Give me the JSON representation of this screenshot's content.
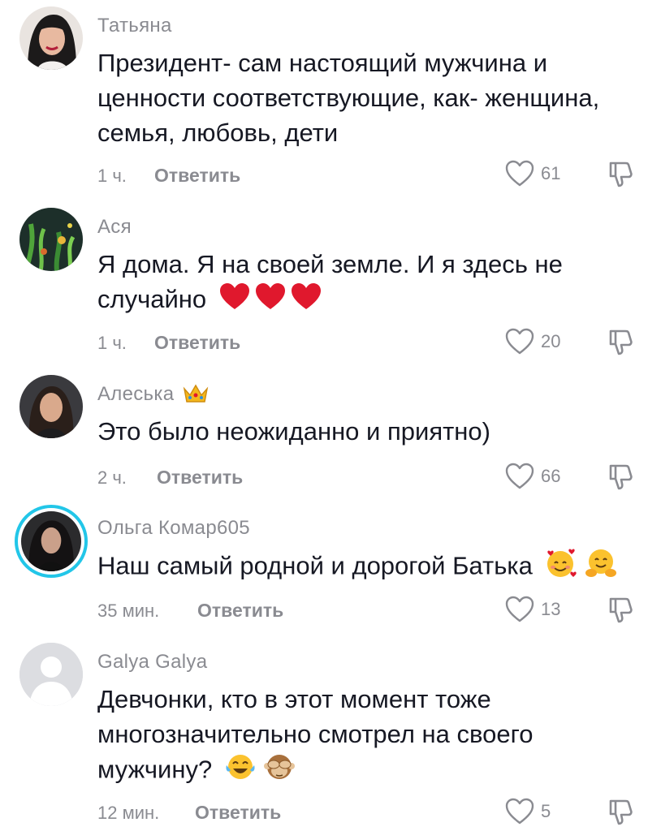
{
  "comments": [
    {
      "username": "Татьяна",
      "lines": [
        "Президент- сам настоящий мужчина и",
        "ценности соответствующие, как- женщина,",
        "семья, любовь, дети"
      ],
      "time": "1 ч.",
      "reply_label": "Ответить",
      "likes": "61",
      "avatar": "woman-dark-hair-avatar"
    },
    {
      "username": "Ася",
      "lines": [
        "Я дома. Я на своей земле. И я здесь не",
        "случайно"
      ],
      "emojis": [
        "red-heart",
        "red-heart",
        "red-heart"
      ],
      "time": "1 ч.",
      "reply_label": "Ответить",
      "likes": "20",
      "avatar": "aquarium-plants-avatar"
    },
    {
      "username": "Алеська",
      "username_emoji": "crown",
      "lines": [
        "Это было неожиданно и приятно)"
      ],
      "time": "2 ч.",
      "reply_label": "Ответить",
      "likes": "66",
      "avatar": "woman-portrait-avatar"
    },
    {
      "username": "Ольга Комар605",
      "lines": [
        "Наш самый родной и дорогой Батька"
      ],
      "emojis": [
        "smiling-face-with-hearts",
        "hugging-face"
      ],
      "time": "35 мин.",
      "reply_label": "Ответить",
      "likes": "13",
      "avatar": "woman-dark-portrait-avatar-story-ring"
    },
    {
      "username": "Galya Galya",
      "lines": [
        "Девчонки, кто в этот момент тоже",
        "многозначительно смотрел на своего",
        "мужчину?"
      ],
      "emojis": [
        "face-with-tears-of-joy",
        "see-no-evil-monkey"
      ],
      "time": "12 мин.",
      "reply_label": "Ответить",
      "likes": "5",
      "avatar": "default-user-avatar"
    }
  ],
  "colors": {
    "text": "#161823",
    "muted": "#8a8b91",
    "story_ring": "#22c6e8",
    "heart": "#e0182d"
  }
}
